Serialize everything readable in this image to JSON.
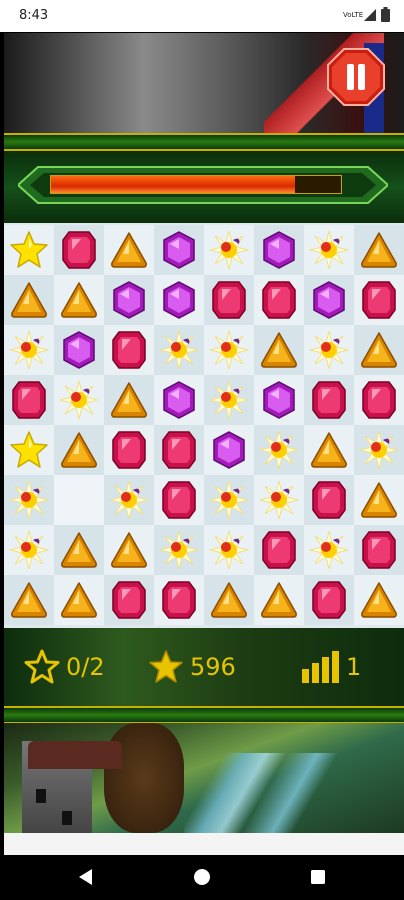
{
  "status_bar": {
    "time": "8:43",
    "network": "VoLTE",
    "icons": [
      "volte-icon",
      "signal-icon",
      "battery-icon"
    ]
  },
  "game": {
    "pause_button": {
      "icon": "pause-icon",
      "color": "#e0301e"
    },
    "level_progress": {
      "fill_fraction": 0.84,
      "fill_color": "#e8461a"
    },
    "board": {
      "cols": 8,
      "rows": 8,
      "empty_cells": [
        [
          5,
          1
        ]
      ],
      "grid": [
        [
          "star",
          "ruby",
          "topaz",
          "amethyst",
          "flower",
          "amethyst",
          "flower",
          "topaz"
        ],
        [
          "topaz",
          "topaz",
          "amethyst",
          "amethyst",
          "ruby",
          "ruby",
          "amethyst",
          "ruby"
        ],
        [
          "flower",
          "amethyst",
          "ruby",
          "flower",
          "flower",
          "topaz",
          "flower",
          "topaz"
        ],
        [
          "ruby",
          "flower",
          "topaz",
          "amethyst",
          "flower",
          "amethyst",
          "ruby",
          "ruby"
        ],
        [
          "star",
          "topaz",
          "ruby",
          "ruby",
          "amethyst",
          "flower",
          "topaz",
          "flower"
        ],
        [
          "flower",
          "empty",
          "flower",
          "ruby",
          "flower",
          "flower",
          "ruby",
          "topaz"
        ],
        [
          "flower",
          "topaz",
          "topaz",
          "flower",
          "flower",
          "ruby",
          "flower",
          "ruby"
        ],
        [
          "topaz",
          "topaz",
          "ruby",
          "ruby",
          "topaz",
          "topaz",
          "ruby",
          "topaz"
        ]
      ]
    },
    "stats": {
      "goal": {
        "icon": "star-outline-icon",
        "text": "0/2"
      },
      "score": {
        "icon": "star-icon",
        "text": "596"
      },
      "level": {
        "icon": "bars-icon",
        "text": "1"
      }
    }
  },
  "nav_bar": {
    "back": "back-icon",
    "home": "home-icon",
    "recents": "recents-icon"
  }
}
